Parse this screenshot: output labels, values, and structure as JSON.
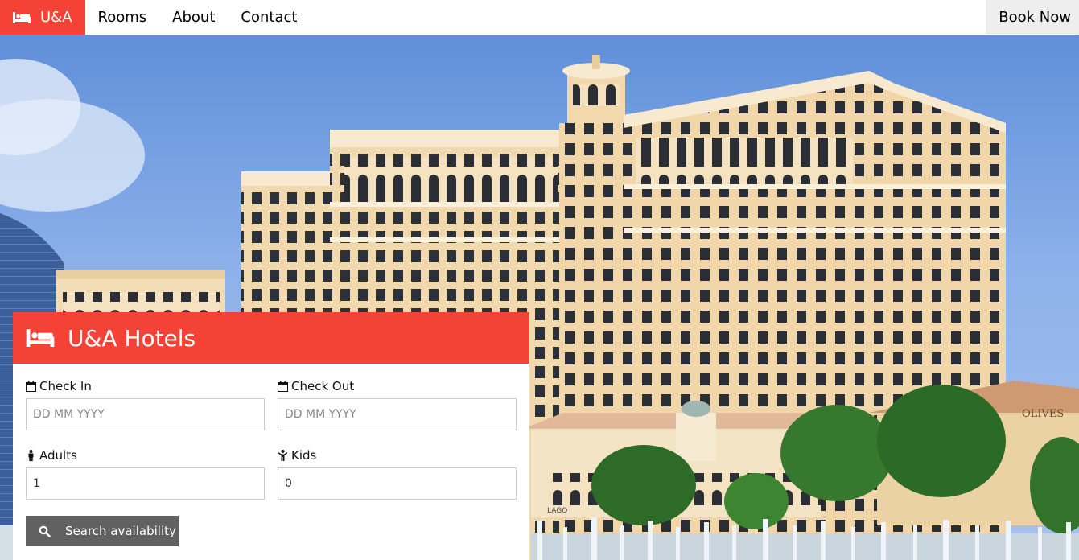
{
  "nav": {
    "brand": "U&A",
    "links": [
      "Rooms",
      "About",
      "Contact"
    ],
    "book_now": "Book Now"
  },
  "booking": {
    "title": "U&A Hotels",
    "check_in": {
      "label": "Check In",
      "placeholder": "DD MM YYYY"
    },
    "check_out": {
      "label": "Check Out",
      "placeholder": "DD MM YYYY"
    },
    "adults": {
      "label": "Adults",
      "value": "1"
    },
    "kids": {
      "label": "Kids",
      "value": "0"
    },
    "search_label": "Search availability"
  },
  "hero": {
    "sign_text": "OLIVES",
    "lago_text": "LAGO"
  },
  "colors": {
    "accent": "#f44336",
    "button": "#616161",
    "building": "#f2d9ad"
  },
  "icons": [
    "bed-icon",
    "calendar-icon",
    "male-icon",
    "child-icon",
    "search-icon"
  ]
}
